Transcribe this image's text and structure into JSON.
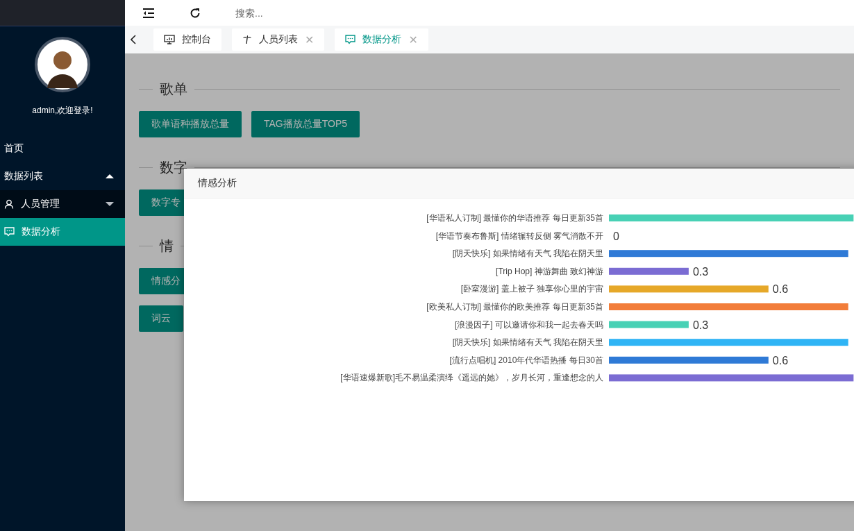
{
  "sidebar": {
    "greeting": "admin,欢迎登录!",
    "items": [
      {
        "label": "首页",
        "selected": false
      },
      {
        "label": "数据列表",
        "selected": false,
        "expanded": true,
        "children": [
          {
            "label": "人员管理",
            "selected": false,
            "expanded": false
          },
          {
            "label": "数据分析",
            "selected": true
          }
        ]
      }
    ]
  },
  "header": {
    "search": {
      "placeholder": "搜索..."
    }
  },
  "tabs": [
    {
      "label": "控制台",
      "selected": false
    },
    {
      "label": "人员列表",
      "close": "✕",
      "selected": false
    },
    {
      "label": "数据分析",
      "close": "✕",
      "selected": true
    }
  ],
  "sections": [
    {
      "title": "歌单",
      "buttons": [
        "歌单语种播放总量",
        "TAG播放总量TOP5"
      ]
    },
    {
      "title": "数字",
      "buttons": [
        "数字专"
      ]
    },
    {
      "title": "情",
      "buttons": [
        "情感分",
        "词云"
      ]
    }
  ],
  "modal": {
    "title": "情感分析",
    "chart_data": {
      "type": "bar",
      "orientation": "horizontal",
      "categories": [
        "[华语私人订制] 最懂你的华语推荐 每日更新35首",
        "[华语节奏布鲁斯] 情绪辗转反侧 雾气消散不开",
        "[阴天快乐] 如果情绪有天气 我陷在阴天里",
        "[Trip Hop] 神游舞曲 致幻神游",
        "[卧室漫游] 盖上被子 独享你心里的宇宙",
        "[欧美私人订制] 最懂你的欧美推荐 每日更新35首",
        "[浪漫因子] 可以邀请你和我一起去春天吗",
        "[阴天快乐] 如果情绪有天气 我陷在阴天里",
        "[流行点唱机] 2010年代华语热播 每日30首",
        "[华语速爆新歌]毛不易温柔演绎《遥远的她》，岁月长河，重逢想念的人"
      ],
      "values": [
        0.92,
        0,
        0.9,
        0.3,
        0.6,
        0.9,
        0.3,
        0.9,
        0.6,
        0.92
      ],
      "value_labels": [
        null,
        "0",
        null,
        "0.3",
        "0.6",
        null,
        "0.3",
        null,
        "0.6",
        null
      ],
      "colors": [
        "#48d1b5",
        null,
        "#2f7ad6",
        "#7b6cd3",
        "#e6a829",
        "#f27d3a",
        "#48d1b5",
        "#2fb4f5",
        "#2f7ad6",
        "#7b6cd3"
      ]
    }
  }
}
